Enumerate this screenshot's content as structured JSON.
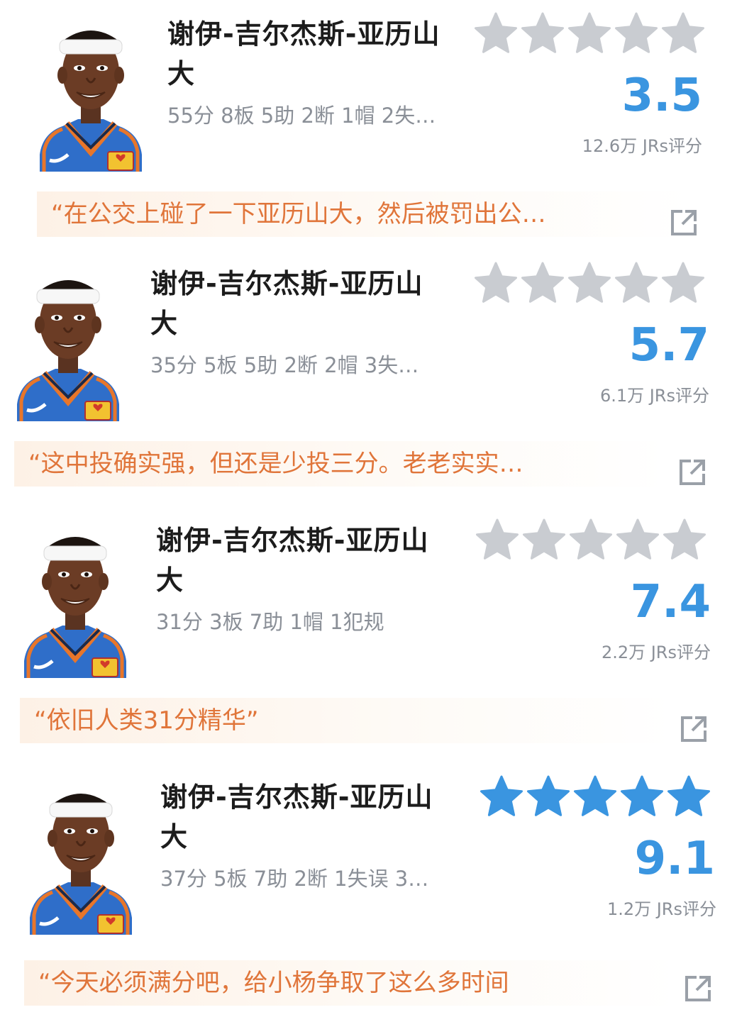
{
  "colors": {
    "accent": "#3a95e0",
    "quote": "#e0753a",
    "muted": "#8a8f97",
    "star_empty": "#c9ccd1",
    "jersey": "#2f6ec9"
  },
  "cards": [
    {
      "name": "谢伊-吉尔杰斯-亚历山大",
      "stats": "55分 8板 5助 2断 1帽 2失…",
      "stars_filled": 0,
      "score": "3.5",
      "count": "12.6万 JRs评分",
      "quote": "“在公交上碰了一下亚历山大，然后被罚出公…",
      "share_icon": "share-icon"
    },
    {
      "name": "谢伊-吉尔杰斯-亚历山大",
      "stats": "35分 5板 5助 2断 2帽 3失…",
      "stars_filled": 0,
      "score": "5.7",
      "count": "6.1万 JRs评分",
      "quote": "“这中投确实强，但还是少投三分。老老实实…",
      "share_icon": "share-icon"
    },
    {
      "name": "谢伊-吉尔杰斯-亚历山大",
      "stats": "31分 3板 7助 1帽 1犯规",
      "stars_filled": 0,
      "score": "7.4",
      "count": "2.2万 JRs评分",
      "quote": "“依旧人类31分精华”",
      "share_icon": "share-icon"
    },
    {
      "name": "谢伊-吉尔杰斯-亚历山大",
      "stats": "37分 5板 7助 2断 1失误 3…",
      "stars_filled": 5,
      "score": "9.1",
      "count": "1.2万 JRs评分",
      "quote": "“今天必须满分吧，给小杨争取了这么多时间",
      "share_icon": "share-icon"
    }
  ]
}
